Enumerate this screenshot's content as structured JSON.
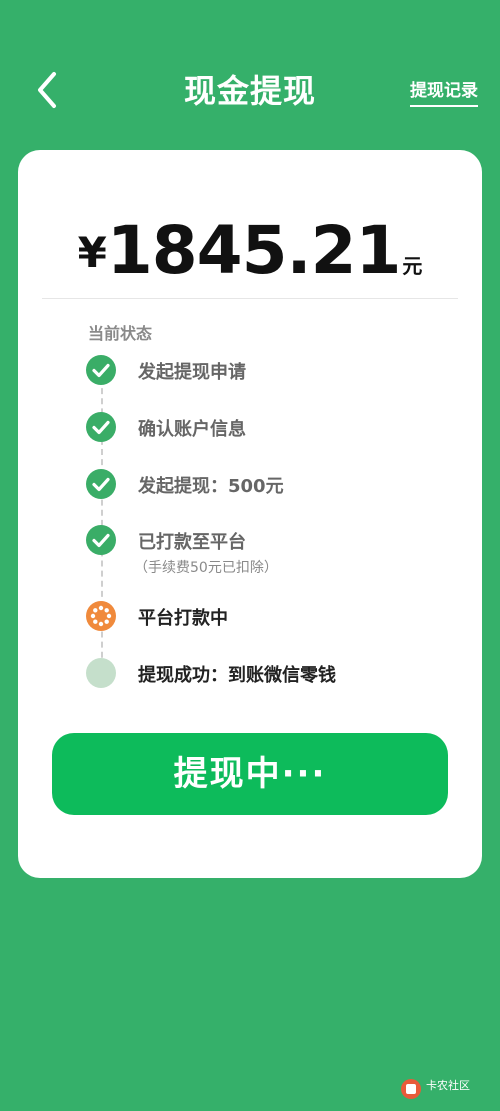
{
  "header": {
    "title": "现金提现",
    "history_link": "提现记录"
  },
  "amount": {
    "currency": "¥",
    "value": "1845.21",
    "unit": "元"
  },
  "status": {
    "label": "当前状态",
    "steps": [
      {
        "title": "发起提现申请",
        "state": "done"
      },
      {
        "title": "确认账户信息",
        "state": "done"
      },
      {
        "title": "发起提现：500元",
        "state": "done"
      },
      {
        "title": "已打款至平台",
        "subtitle": "（手续费50元已扣除）",
        "state": "done"
      },
      {
        "title": "平台打款中",
        "state": "active"
      },
      {
        "title": "提现成功：到账微信零钱",
        "state": "pending"
      }
    ]
  },
  "button": {
    "label": "提现中···"
  },
  "watermark": {
    "text": "卡农社区"
  },
  "colors": {
    "background": "#35b06a",
    "button": "#0dbb5b",
    "done": "#3aad67",
    "active": "#f08a3c",
    "pending": "#c5dfcb"
  }
}
